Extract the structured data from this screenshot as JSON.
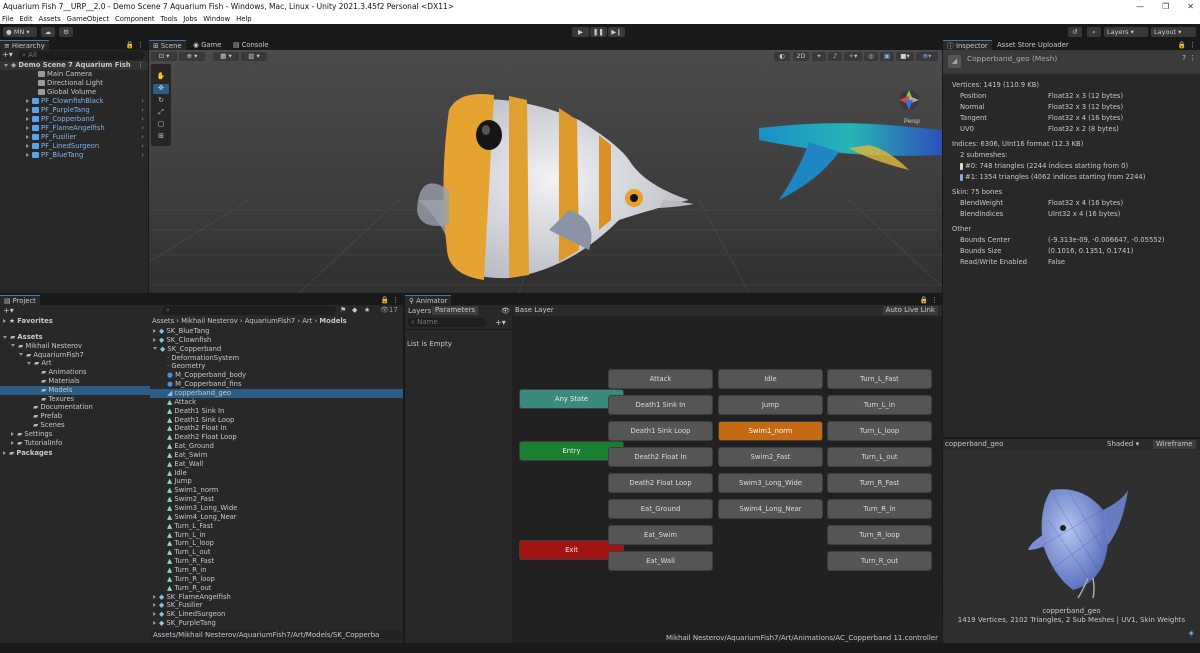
{
  "window": {
    "title": "Aquarium Fish 7__URP__2.0 - Demo Scene 7 Aquarium Fish - Windows, Mac, Linux - Unity 2021.3.45f2 Personal <DX11>",
    "controls": [
      "—",
      "❐",
      "✕"
    ]
  },
  "menu": [
    "File",
    "Edit",
    "Assets",
    "GameObject",
    "Component",
    "Tools",
    "Jobs",
    "Window",
    "Help"
  ],
  "toolbar": {
    "account": "MN",
    "layers": "Layers",
    "layout": "Layout"
  },
  "hierarchy": {
    "tab": "Hierarchy",
    "search_placeholder": "All",
    "scene": "Demo Scene 7 Aquarium Fish",
    "items": [
      {
        "label": "Main Camera",
        "prefab": false
      },
      {
        "label": "Directional Light",
        "prefab": false
      },
      {
        "label": "Global Volume",
        "prefab": false
      },
      {
        "label": "PF_ClownfishBlack",
        "prefab": true
      },
      {
        "label": "PF_PurpleTang",
        "prefab": true
      },
      {
        "label": "PF_Copperband",
        "prefab": true
      },
      {
        "label": "PF_FlameAngelfish",
        "prefab": true
      },
      {
        "label": "PF_Fusilier",
        "prefab": true
      },
      {
        "label": "PF_LinedSurgeon",
        "prefab": true
      },
      {
        "label": "PF_BlueTang",
        "prefab": true
      }
    ]
  },
  "scene_view": {
    "tabs": [
      "Scene",
      "Game",
      "Console"
    ],
    "mode_2d": "2D",
    "gizmo_label": "Persp"
  },
  "project": {
    "tab": "Project",
    "favorites": "Favorites",
    "tree": [
      {
        "label": "Assets",
        "depth": 0,
        "open": true
      },
      {
        "label": "Mikhail Nesterov",
        "depth": 1,
        "open": true
      },
      {
        "label": "AquariumFish7",
        "depth": 2,
        "open": true
      },
      {
        "label": "Art",
        "depth": 3,
        "open": true
      },
      {
        "label": "Animations",
        "depth": 4
      },
      {
        "label": "Materials",
        "depth": 4
      },
      {
        "label": "Models",
        "depth": 4,
        "selected": true
      },
      {
        "label": "Texures",
        "depth": 4
      },
      {
        "label": "Documentation",
        "depth": 3
      },
      {
        "label": "Prefab",
        "depth": 3
      },
      {
        "label": "Scenes",
        "depth": 3
      },
      {
        "label": "Settings",
        "depth": 1
      },
      {
        "label": "TutorialInfo",
        "depth": 1
      },
      {
        "label": "Packages",
        "depth": 0
      }
    ],
    "breadcrumb": [
      "Assets",
      "Mikhail Nesterov",
      "AquariumFish7",
      "Art",
      "Models"
    ],
    "count": "17",
    "files": [
      {
        "label": "SK_BlueTang",
        "depth": 0,
        "kind": "model"
      },
      {
        "label": "SK_Clownfish",
        "depth": 0,
        "kind": "model"
      },
      {
        "label": "SK_Copperband",
        "depth": 0,
        "kind": "model",
        "open": true
      },
      {
        "label": "DeformationSystem",
        "depth": 1,
        "kind": "empty"
      },
      {
        "label": "Geometry",
        "depth": 1,
        "kind": "empty"
      },
      {
        "label": "M_Copperband_body",
        "depth": 1,
        "kind": "material"
      },
      {
        "label": "M_Copperband_fins",
        "depth": 1,
        "kind": "material"
      },
      {
        "label": "copperband_geo",
        "depth": 1,
        "kind": "mesh",
        "selected": true
      },
      {
        "label": "Attack",
        "depth": 1,
        "kind": "anim"
      },
      {
        "label": "Death1 Sink In",
        "depth": 1,
        "kind": "anim"
      },
      {
        "label": "Death1 Sink Loop",
        "depth": 1,
        "kind": "anim"
      },
      {
        "label": "Death2 Float In",
        "depth": 1,
        "kind": "anim"
      },
      {
        "label": "Death2 Float Loop",
        "depth": 1,
        "kind": "anim"
      },
      {
        "label": "Eat_Ground",
        "depth": 1,
        "kind": "anim"
      },
      {
        "label": "Eat_Swim",
        "depth": 1,
        "kind": "anim"
      },
      {
        "label": "Eat_Wall",
        "depth": 1,
        "kind": "anim"
      },
      {
        "label": "Idle",
        "depth": 1,
        "kind": "anim"
      },
      {
        "label": "Jump",
        "depth": 1,
        "kind": "anim"
      },
      {
        "label": "Swim1_norm",
        "depth": 1,
        "kind": "anim"
      },
      {
        "label": "Swim2_Fast",
        "depth": 1,
        "kind": "anim"
      },
      {
        "label": "Swim3_Long_Wide",
        "depth": 1,
        "kind": "anim"
      },
      {
        "label": "Swim4_Long_Near",
        "depth": 1,
        "kind": "anim"
      },
      {
        "label": "Turn_L_Fast",
        "depth": 1,
        "kind": "anim"
      },
      {
        "label": "Turn_L_in",
        "depth": 1,
        "kind": "anim"
      },
      {
        "label": "Turn_L_loop",
        "depth": 1,
        "kind": "anim"
      },
      {
        "label": "Turn_L_out",
        "depth": 1,
        "kind": "anim"
      },
      {
        "label": "Turn_R_Fast",
        "depth": 1,
        "kind": "anim"
      },
      {
        "label": "Turn_R_in",
        "depth": 1,
        "kind": "anim"
      },
      {
        "label": "Turn_R_loop",
        "depth": 1,
        "kind": "anim"
      },
      {
        "label": "Turn_R_out",
        "depth": 1,
        "kind": "anim"
      },
      {
        "label": "SK_FlameAngelfish",
        "depth": 0,
        "kind": "model"
      },
      {
        "label": "SK_Fusilier",
        "depth": 0,
        "kind": "model"
      },
      {
        "label": "SK_LinedSurgeon",
        "depth": 0,
        "kind": "model"
      },
      {
        "label": "SK_PurpleTang",
        "depth": 0,
        "kind": "model"
      }
    ],
    "status_path": "Assets/Mikhail Nesterov/AquariumFish7/Art/Models/SK_Copperba"
  },
  "animator": {
    "tab": "Animator",
    "subtabs": [
      "Layers",
      "Parameters"
    ],
    "layer_title": "Base Layer",
    "auto_live_link": "Auto Live Link",
    "search_placeholder": "Name",
    "list_empty": "List is Empty",
    "footer_path": "Mikhail Nesterov/AquariumFish7/Art/Animations/AC_Copperband 11.controller",
    "special_nodes": {
      "any_state": "Any State",
      "entry": "Entry",
      "exit": "Exit"
    },
    "col1": [
      "Attack",
      "Death1 Sink In",
      "Death1 Sink Loop",
      "Death2 Float In",
      "Death2 Float Loop",
      "Eat_Ground",
      "Eat_Swim",
      "Eat_Wall"
    ],
    "col2": [
      "Idle",
      "Jump",
      "Swim1_norm",
      "Swim2_Fast",
      "Swim3_Long_Wide",
      "Swim4_Long_Near"
    ],
    "col3": [
      "Turn_L_Fast",
      "Turn_L_in",
      "Turn_L_loop",
      "Turn_L_out",
      "Turn_R_Fast",
      "Turn_R_in",
      "Turn_R_loop",
      "Turn_R_out"
    ],
    "default_state": "Swim1_norm"
  },
  "inspector": {
    "tabs": [
      "Inspector",
      "Asset Store Uploader"
    ],
    "object_title": "Copperband_geo (Mesh)",
    "vertices_header": "Vertices: 1419 (110.9 KB)",
    "vertex_attrs": [
      {
        "name": "Position",
        "value": "Float32 x 3 (12 bytes)"
      },
      {
        "name": "Normal",
        "value": "Float32 x 3 (12 bytes)"
      },
      {
        "name": "Tangent",
        "value": "Float32 x 4 (16 bytes)"
      },
      {
        "name": "UV0",
        "value": "Float32 x 2 (8 bytes)"
      }
    ],
    "indices_header": "Indices: 6306, UInt16 format (12.3 KB)",
    "submeshes_label": "2 submeshes:",
    "submeshes": [
      {
        "text": "#0: 748 triangles (2244 indices starting from 0)",
        "color": "#d9d9d9"
      },
      {
        "text": "#1: 1354 triangles (4062 indices starting from 2244)",
        "color": "#8aa6e8"
      }
    ],
    "skin_header": "Skin: 75 bones",
    "skin_attrs": [
      {
        "name": "BlendWeight",
        "value": "Float32 x 4 (16 bytes)"
      },
      {
        "name": "BlendIndices",
        "value": "UInt32 x 4 (16 bytes)"
      }
    ],
    "other_header": "Other",
    "other_attrs": [
      {
        "name": "Bounds Center",
        "value": "(-9.313e-09, -0.006647, -0.05552)"
      },
      {
        "name": "Bounds Size",
        "value": "(0.1016, 0.1351, 0.1741)"
      },
      {
        "name": "Read/Write Enabled",
        "value": "False"
      }
    ],
    "preview": {
      "name": "copperband_geo",
      "shaded": "Shaded",
      "wireframe": "Wireframe",
      "caption_name": "copperband_geo",
      "caption_stats": "1419 Vertices, 2102 Triangles, 2 Sub Meshes | UV1, Skin Weights"
    }
  }
}
